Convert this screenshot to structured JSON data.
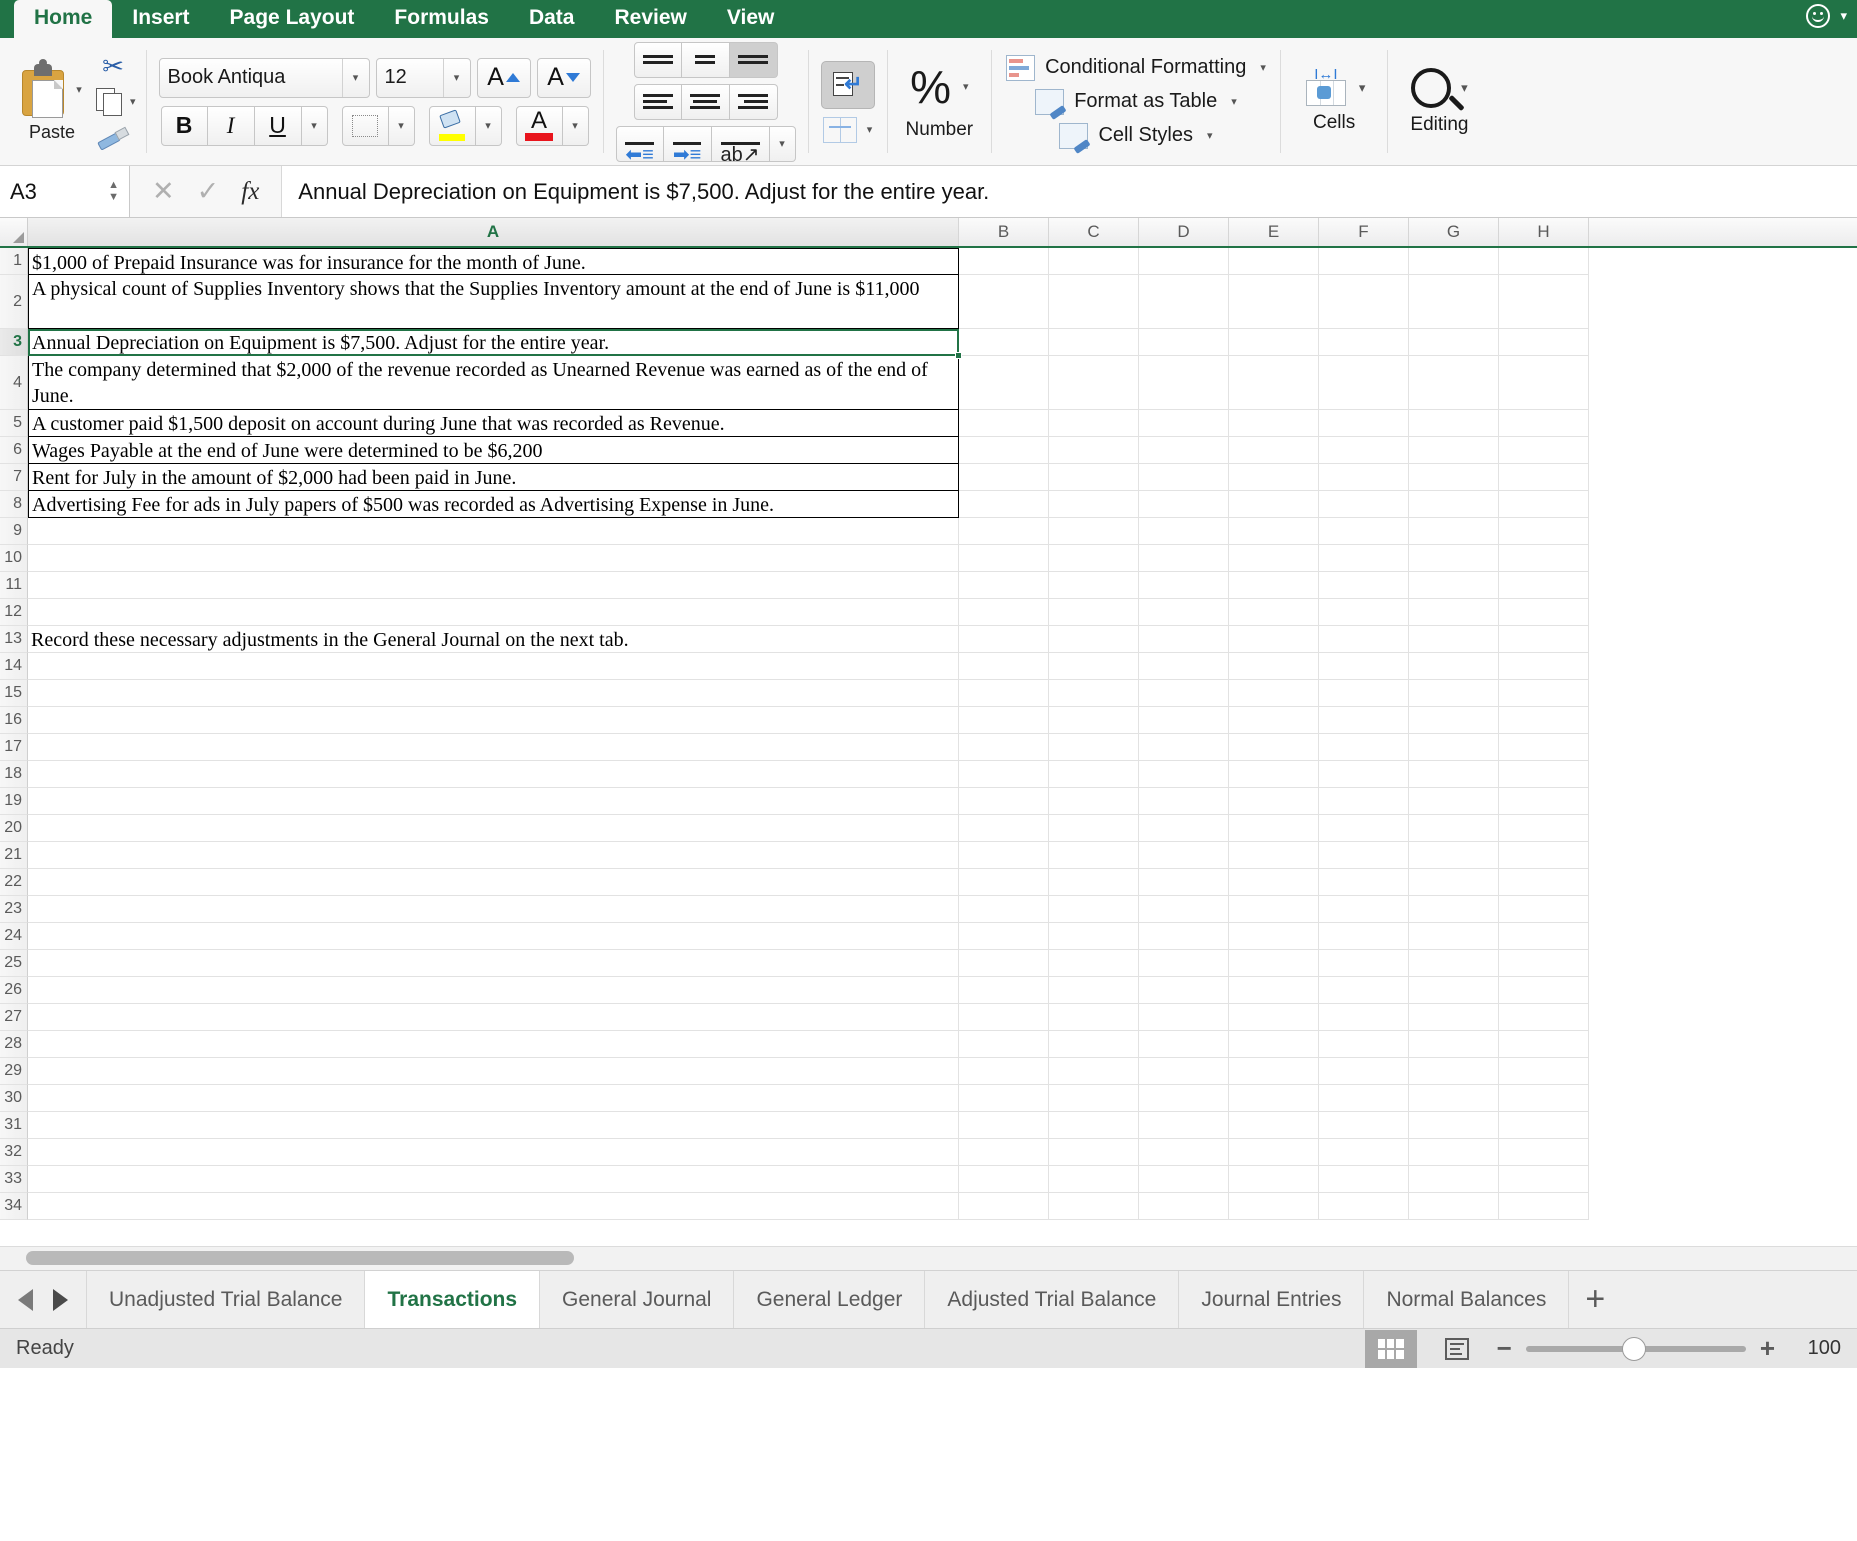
{
  "ribbon": {
    "tabs": [
      {
        "label": "Home",
        "active": true
      },
      {
        "label": "Insert",
        "active": false
      },
      {
        "label": "Page Layout",
        "active": false
      },
      {
        "label": "Formulas",
        "active": false
      },
      {
        "label": "Data",
        "active": false
      },
      {
        "label": "Review",
        "active": false
      },
      {
        "label": "View",
        "active": false
      }
    ],
    "clipboard": {
      "paste_label": "Paste",
      "cut_icon": "scissors-icon",
      "copy_icon": "copy-icon",
      "format_painter_icon": "format-painter-icon"
    },
    "font": {
      "family": "Book Antiqua",
      "size": "12",
      "grow_label": "A",
      "shrink_label": "A",
      "bold_label": "B",
      "italic_label": "I",
      "underline_label": "U",
      "borders_icon": "borders-icon",
      "fill_color_icon": "fill-color-icon",
      "font_color_label": "A",
      "font_color_hex": "#e8141c",
      "fill_color_hex": "#ffff00"
    },
    "alignment": {
      "top_align_icon": "align-top-icon",
      "middle_align_icon": "align-middle-icon",
      "bottom_align_icon": "align-bottom-icon",
      "align_left_icon": "align-left-icon",
      "align_center_icon": "align-center-icon",
      "align_right_icon": "align-right-icon",
      "decrease_indent_icon": "decrease-indent-icon",
      "increase_indent_icon": "increase-indent-icon",
      "orientation_icon": "orientation-icon",
      "wrap_text_icon": "wrap-text-icon",
      "merge_center_icon": "merge-and-center-icon"
    },
    "number": {
      "percent_label": "%",
      "group_label": "Number"
    },
    "styles": {
      "conditional_formatting": "Conditional Formatting",
      "format_as_table": "Format as Table",
      "cell_styles": "Cell Styles"
    },
    "cells": {
      "label": "Cells"
    },
    "editing": {
      "label": "Editing",
      "icon": "magnifier-icon"
    },
    "accent_hex": "#217346"
  },
  "formula_bar": {
    "name_box": "A3",
    "cancel_icon": "cancel-x-icon",
    "enter_icon": "confirm-check-icon",
    "fx_label": "fx",
    "content": "Annual Depreciation on Equipment is $7,500. Adjust for the entire year."
  },
  "grid": {
    "columns": [
      "A",
      "B",
      "C",
      "D",
      "E",
      "F",
      "G",
      "H"
    ],
    "selected_column": "A",
    "selected_row": 3,
    "rows": [
      {
        "n": 1,
        "a": "$1,000 of Prepaid Insurance was for insurance for the month of June.",
        "boxed": true,
        "tall": false
      },
      {
        "n": 2,
        "a": "A physical count of Supplies Inventory shows that the Supplies Inventory amount at the end of June is $11,000",
        "boxed": true,
        "tall": true
      },
      {
        "n": 3,
        "a": "Annual Depreciation on Equipment is $7,500. Adjust for the entire year.",
        "boxed": true,
        "tall": false
      },
      {
        "n": 4,
        "a": "The company determined that $2,000 of the revenue recorded as Unearned Revenue was earned as of the end of June.",
        "boxed": true,
        "tall": true
      },
      {
        "n": 5,
        "a": "A customer paid $1,500 deposit on account during June that was recorded as Revenue.",
        "boxed": true,
        "tall": false
      },
      {
        "n": 6,
        "a": "Wages Payable at the end of June were determined to be $6,200",
        "boxed": true,
        "tall": false
      },
      {
        "n": 7,
        "a": "Rent for July in the amount of $2,000 had been paid in June.",
        "boxed": true,
        "tall": false
      },
      {
        "n": 8,
        "a": "Advertising Fee for ads in July papers of $500 was recorded as Advertising Expense in June.",
        "boxed": true,
        "tall": false
      },
      {
        "n": 9,
        "a": "",
        "boxed": false,
        "tall": false
      },
      {
        "n": 10,
        "a": "",
        "boxed": false,
        "tall": false
      },
      {
        "n": 11,
        "a": "",
        "boxed": false,
        "tall": false
      },
      {
        "n": 12,
        "a": "",
        "boxed": false,
        "tall": false
      },
      {
        "n": 13,
        "a": "Record these necessary adjustments in the General Journal on the next tab.",
        "boxed": false,
        "tall": false
      },
      {
        "n": 14,
        "a": "",
        "boxed": false,
        "tall": false
      },
      {
        "n": 15,
        "a": "",
        "boxed": false,
        "tall": false
      },
      {
        "n": 16,
        "a": "",
        "boxed": false,
        "tall": false
      },
      {
        "n": 17,
        "a": "",
        "boxed": false,
        "tall": false
      },
      {
        "n": 18,
        "a": "",
        "boxed": false,
        "tall": false
      },
      {
        "n": 19,
        "a": "",
        "boxed": false,
        "tall": false
      },
      {
        "n": 20,
        "a": "",
        "boxed": false,
        "tall": false
      },
      {
        "n": 21,
        "a": "",
        "boxed": false,
        "tall": false
      },
      {
        "n": 22,
        "a": "",
        "boxed": false,
        "tall": false
      },
      {
        "n": 23,
        "a": "",
        "boxed": false,
        "tall": false
      },
      {
        "n": 24,
        "a": "",
        "boxed": false,
        "tall": false
      },
      {
        "n": 25,
        "a": "",
        "boxed": false,
        "tall": false
      },
      {
        "n": 26,
        "a": "",
        "boxed": false,
        "tall": false
      },
      {
        "n": 27,
        "a": "",
        "boxed": false,
        "tall": false
      },
      {
        "n": 28,
        "a": "",
        "boxed": false,
        "tall": false
      },
      {
        "n": 29,
        "a": "",
        "boxed": false,
        "tall": false
      },
      {
        "n": 30,
        "a": "",
        "boxed": false,
        "tall": false
      },
      {
        "n": 31,
        "a": "",
        "boxed": false,
        "tall": false
      },
      {
        "n": 32,
        "a": "",
        "boxed": false,
        "tall": false
      },
      {
        "n": 33,
        "a": "",
        "boxed": false,
        "tall": false
      },
      {
        "n": 34,
        "a": "",
        "boxed": false,
        "tall": false
      }
    ]
  },
  "sheet_tabs": {
    "prev_icon": "previous-sheet-arrow",
    "next_icon": "next-sheet-arrow",
    "add_label": "+",
    "tabs": [
      {
        "label": "Unadjusted Trial Balance",
        "active": false
      },
      {
        "label": "Transactions",
        "active": true
      },
      {
        "label": "General Journal",
        "active": false
      },
      {
        "label": "General Ledger",
        "active": false
      },
      {
        "label": "Adjusted Trial Balance",
        "active": false
      },
      {
        "label": "Journal Entries",
        "active": false
      },
      {
        "label": "Normal Balances",
        "active": false
      }
    ]
  },
  "status_bar": {
    "message": "Ready",
    "normal_view_icon": "normal-view-icon",
    "page_layout_icon": "page-layout-view-icon",
    "zoom_out_label": "−",
    "zoom_in_label": "+",
    "zoom_value": "100"
  }
}
